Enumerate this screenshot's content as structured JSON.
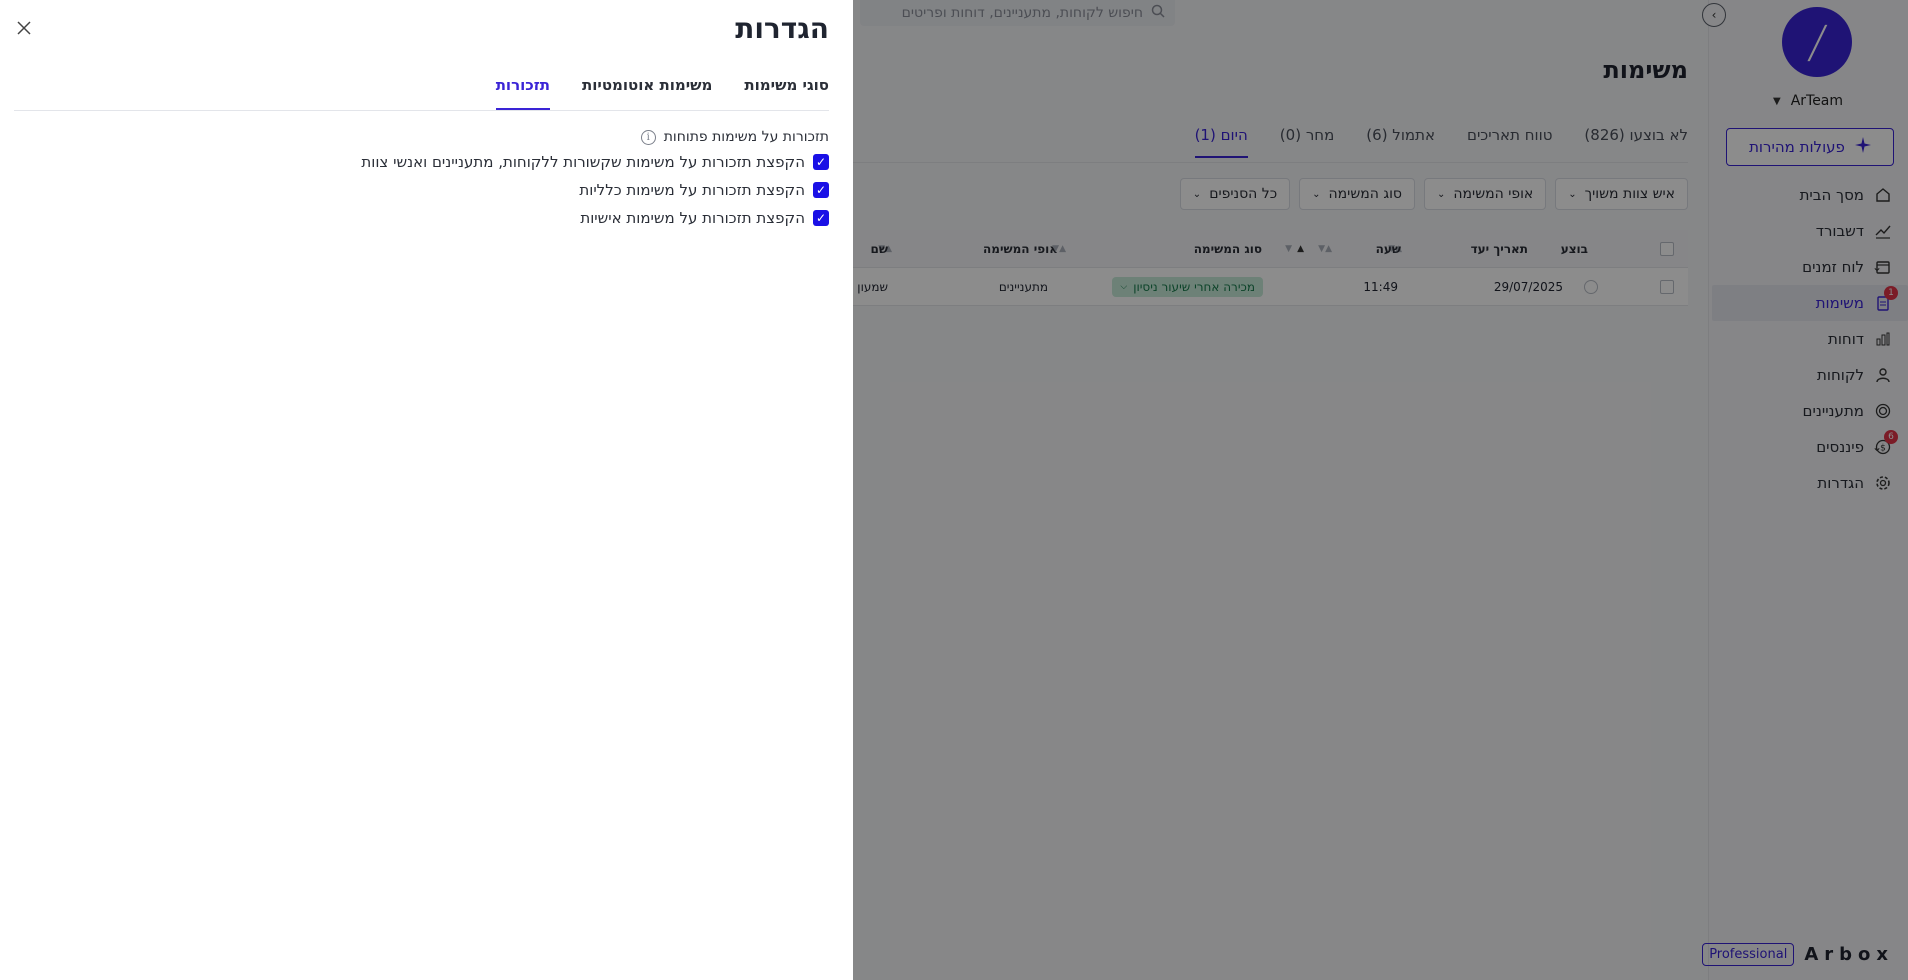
{
  "sidebar": {
    "org_name": "ArTeam",
    "quick_actions": "פעולות מהירות",
    "items": [
      {
        "label": "מסך הבית",
        "icon": "home-icon"
      },
      {
        "label": "דשבורד",
        "icon": "trend-icon"
      },
      {
        "label": "לוח זמנים",
        "icon": "calendar-icon",
        "expandable": true
      },
      {
        "label": "משימות",
        "icon": "clipboard-icon",
        "badge": "1",
        "active": true
      },
      {
        "label": "דוחות",
        "icon": "bar-chart-icon"
      },
      {
        "label": "לקוחות",
        "icon": "user-icon"
      },
      {
        "label": "מתעניינים",
        "icon": "target-icon"
      },
      {
        "label": "פיננסים",
        "icon": "dollar-icon",
        "badge": "6",
        "expandable": true
      },
      {
        "label": "הגדרות",
        "icon": "gear-icon"
      }
    ],
    "plan": "Professional",
    "brand": "Arbox"
  },
  "search": {
    "placeholder": "חיפוש לקוחות, מתעניינים, דוחות ופריטים"
  },
  "main": {
    "title": "משימות",
    "tabs": [
      "היום (1)",
      "מחר (0)",
      "אתמול (6)",
      "טווח תאריכים",
      "לא בוצעו (826)"
    ],
    "filters": [
      "כל הסניפים",
      "סוג המשימה",
      "אופי המשימה",
      "איש צוות משויך"
    ],
    "table": {
      "headers": {
        "done": "בוצע",
        "due": "תאריך יעד",
        "time": "שעה",
        "type": "סוג המשימה",
        "nature": "אופי המשימה",
        "name": "שם"
      },
      "rows": [
        {
          "due": "29/07/2025",
          "time": "11:49",
          "type": "מכירה אחרי שיעור ניסיון",
          "nature": "מתעניינים",
          "name": "שמעון"
        }
      ]
    }
  },
  "drawer": {
    "title": "הגדרות",
    "tabs": [
      "סוגי משימות",
      "משימות אוטומטיות",
      "תזכורות"
    ],
    "active_tab": 2,
    "section_title": "תזכורות על משימות פתוחות",
    "options": [
      {
        "label": "הקפצת תזכורות על משימות שקשורות ללקוחות, מתעניינים ואנשי צוות",
        "checked": true
      },
      {
        "label": "הקפצת תזכורות על משימות כלליות",
        "checked": true
      },
      {
        "label": "הקפצת תזכורות על משימות אישיות",
        "checked": true
      }
    ]
  },
  "colors": {
    "accent": "#3a24d6",
    "checkbox": "#1a10e6",
    "badge": "#e03348",
    "tag_bg": "#c7ecd9"
  }
}
